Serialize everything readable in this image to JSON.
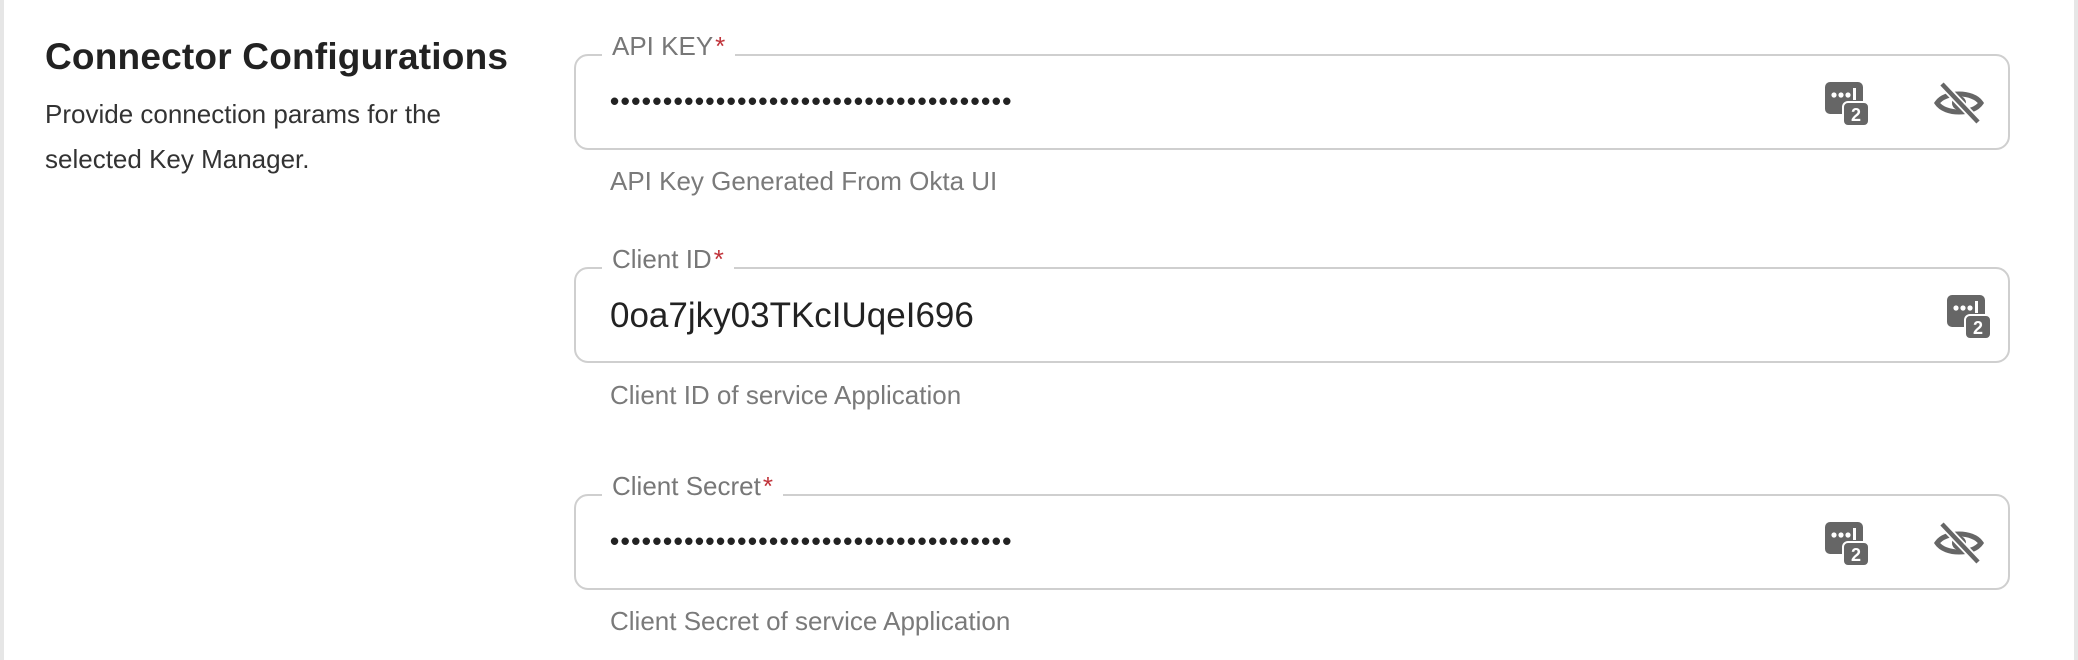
{
  "section": {
    "title": "Connector Configurations",
    "description": "Provide connection params for the selected Key Manager."
  },
  "fields": [
    {
      "label": "API KEY",
      "required_mark": "*",
      "value": "••••••••••••••••••••••••••••••••••••••",
      "helper": "API Key Generated From Okta UI",
      "icons": [
        "password-generator-icon",
        "eye-off-icon"
      ]
    },
    {
      "label": "Client ID",
      "required_mark": "*",
      "value": "0oa7jky03TKcIUqeI696",
      "helper": "Client ID of service Application",
      "icons": [
        "password-generator-icon"
      ]
    },
    {
      "label": "Client Secret",
      "required_mark": "*",
      "value": "••••••••••••••••••••••••••••••••••••••",
      "helper": "Client Secret of service Application",
      "icons": [
        "password-generator-icon",
        "eye-off-icon"
      ]
    }
  ],
  "colors": {
    "required": "#c0333a",
    "border": "#cfcfcf",
    "icon": "#666666"
  }
}
